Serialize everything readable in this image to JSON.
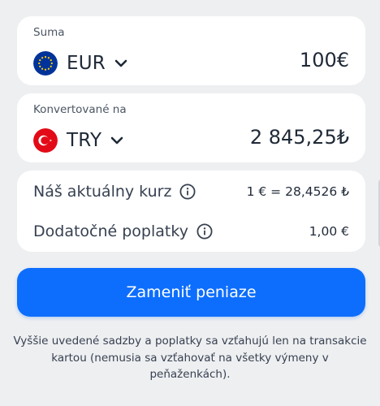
{
  "from": {
    "label": "Suma",
    "currency": "EUR",
    "flag_icon": "eu-flag-icon",
    "amount": "100€"
  },
  "to": {
    "label": "Konvertované na",
    "currency": "TRY",
    "flag_icon": "turkey-flag-icon",
    "amount": "2 845,25₺"
  },
  "rates": {
    "rate_label": "Náš aktuálny kurz",
    "rate_value": "1 € = 28,4526 ₺",
    "fees_label": "Dodatočné poplatky",
    "fees_value": "1,00 €"
  },
  "exchange_button_label": "Zameniť peniaze",
  "disclaimer": "Vyššie uvedené sadzby a poplatky sa vzťahujú len na transakcie kartou (nemusia sa vzťahovať na všetky výmeny v peňaženkách).",
  "colors": {
    "accent": "#0d6efd",
    "background": "#eeeff1",
    "card": "#ffffff",
    "eu_blue": "#003399",
    "eu_stars": "#ffcc00",
    "turkey_red": "#e30a17"
  }
}
